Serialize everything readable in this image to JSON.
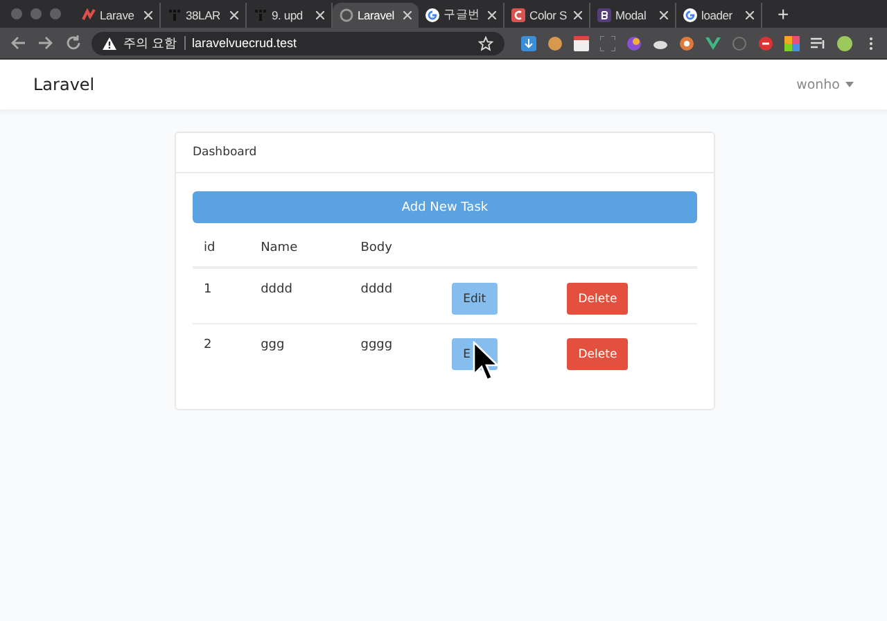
{
  "browser": {
    "tabs": [
      {
        "title": "Larave",
        "selected": false
      },
      {
        "title": "38LAR",
        "selected": false
      },
      {
        "title": "9. upd",
        "selected": false
      },
      {
        "title": "Laravel",
        "selected": true
      },
      {
        "title": "구글번",
        "selected": false
      },
      {
        "title": "Color S",
        "selected": false
      },
      {
        "title": "Modal",
        "selected": false
      },
      {
        "title": "loader",
        "selected": false
      }
    ],
    "new_tab": "+",
    "security": "주의 요함",
    "url": "laravelvuecrud.test"
  },
  "navbar": {
    "brand": "Laravel",
    "user": "wonho"
  },
  "card": {
    "header": "Dashboard",
    "add_button": "Add New Task",
    "columns": [
      "id",
      "Name",
      "Body"
    ],
    "rows": [
      {
        "id": "1",
        "name": "dddd",
        "body": "dddd",
        "edit": "Edit",
        "delete": "Delete"
      },
      {
        "id": "2",
        "name": "ggg",
        "body": "gggg",
        "edit": "E",
        "delete": "Delete",
        "cursor": true
      }
    ]
  }
}
